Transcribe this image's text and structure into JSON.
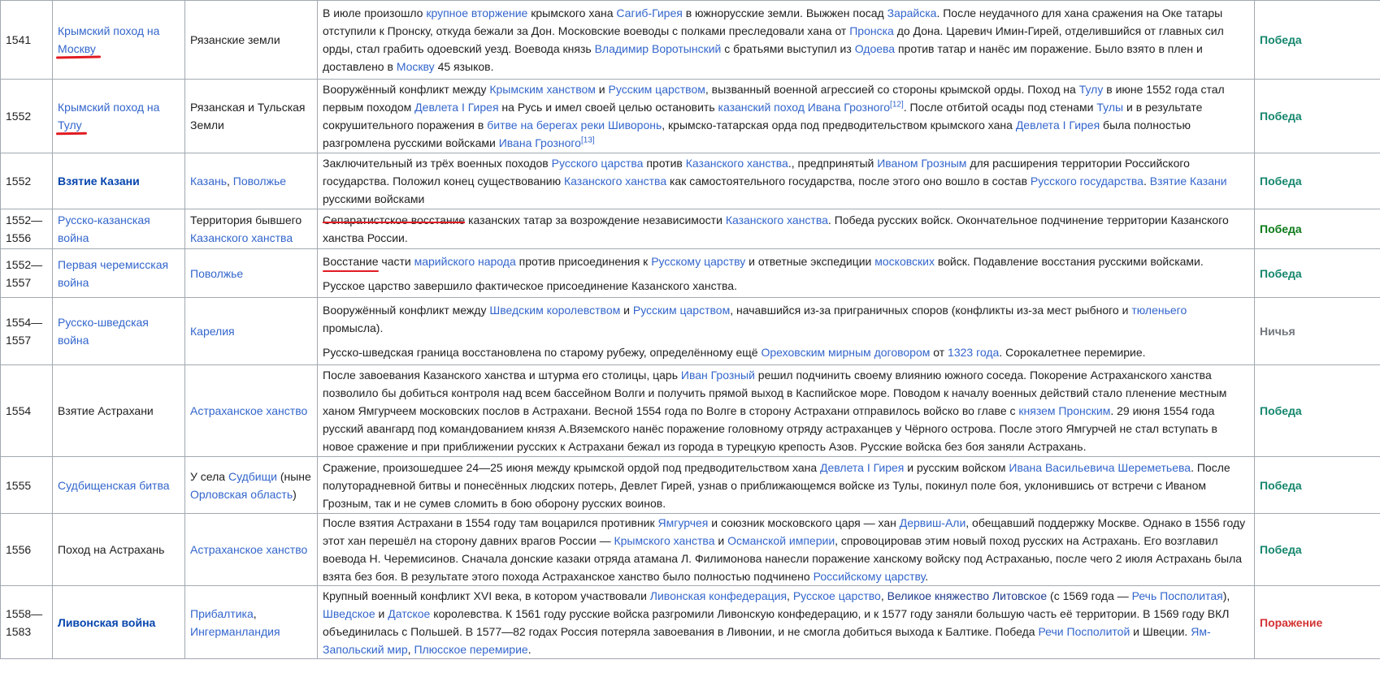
{
  "rows": [
    {
      "year": "1541",
      "name": [
        {
          "t": "Крымский поход на Москву",
          "s": "lk",
          "m": "ul"
        }
      ],
      "place": [
        {
          "t": "Рязанские земли",
          "s": "bl"
        }
      ],
      "desc": [
        [
          {
            "t": "В июле произошло ",
            "s": "bl"
          },
          {
            "t": "крупное вторжение",
            "s": "lk"
          },
          {
            "t": " крымского хана ",
            "s": "bl"
          },
          {
            "t": "Сагиб-Гирея",
            "s": "lk"
          },
          {
            "t": " в южнорусские земли. Выжжен посад ",
            "s": "bl"
          },
          {
            "t": "Зарайска",
            "s": "lk"
          },
          {
            "t": ". После неудачного для хана сражения на Оке татары отступили к Пронску, откуда бежали за Дон. Московские воеводы с полками преследовали хана от ",
            "s": "bl"
          },
          {
            "t": "Пронска",
            "s": "lk"
          },
          {
            "t": " до Дона. Царевич Имин-Гирей, отделившийся от главных сил орды, стал грабить одоевский уезд. Воевода князь ",
            "s": "bl"
          },
          {
            "t": "Владимир Воротынский",
            "s": "lk"
          },
          {
            "t": " с братьями выступил из ",
            "s": "bl"
          },
          {
            "t": "Одоева",
            "s": "lk"
          },
          {
            "t": " против татар и нанёс им поражение. Было взято в плен и доставлено в ",
            "s": "bl"
          },
          {
            "t": "Москву",
            "s": "lk"
          },
          {
            "t": " 45 языков.",
            "s": "bl"
          }
        ]
      ],
      "result": "Победа",
      "rclass": "r-victory"
    },
    {
      "year": "1552",
      "name": [
        {
          "t": "Крымский поход на Тулу",
          "s": "lk",
          "m": "ul"
        }
      ],
      "place": [
        {
          "t": "Рязанская и Тульская Земли",
          "s": "bl"
        }
      ],
      "desc": [
        [
          {
            "t": "Вооружённый конфликт между ",
            "s": "bl"
          },
          {
            "t": "Крымским ханством",
            "s": "lk"
          },
          {
            "t": " и ",
            "s": "bl"
          },
          {
            "t": "Русским царством",
            "s": "lk"
          },
          {
            "t": ", вызванный военной агрессией со стороны крымской орды. Поход на ",
            "s": "bl"
          },
          {
            "t": "Тулу",
            "s": "lk"
          },
          {
            "t": " в июне 1552 года стал первым походом ",
            "s": "bl"
          },
          {
            "t": "Девлета I Гирея",
            "s": "lk"
          },
          {
            "t": " на Русь и имел своей целью остановить ",
            "s": "bl"
          },
          {
            "t": "казанский поход Ивана Грозного",
            "s": "lk"
          },
          {
            "t": "[12]",
            "s": "sup"
          },
          {
            "t": ". После отбитой осады под стенами ",
            "s": "bl"
          },
          {
            "t": "Тулы",
            "s": "lk"
          },
          {
            "t": " и в результате сокрушительного поражения в ",
            "s": "bl"
          },
          {
            "t": "битве на берегах реки Шиворонь",
            "s": "lk"
          },
          {
            "t": ", крымско-татарская орда под предводительством крымского хана ",
            "s": "bl"
          },
          {
            "t": "Девлета I Гирея",
            "s": "lk"
          },
          {
            "t": " была полностью разгромлена русскими войсками ",
            "s": "bl"
          },
          {
            "t": "Ивана Грозного",
            "s": "lk"
          },
          {
            "t": "[13]",
            "s": "sup"
          }
        ]
      ],
      "result": "Победа",
      "rclass": "r-victory"
    },
    {
      "year": "1552",
      "name": [
        {
          "t": "Взятие Казани",
          "s": "lkdb"
        }
      ],
      "place": [
        {
          "t": "Казань",
          "s": "lk"
        },
        {
          "t": ", ",
          "s": "bl"
        },
        {
          "t": "Поволжье",
          "s": "lk"
        }
      ],
      "desc": [
        [
          {
            "t": "Заключительный из трёх военных походов ",
            "s": "bl"
          },
          {
            "t": "Русского царства",
            "s": "lk"
          },
          {
            "t": " против ",
            "s": "bl"
          },
          {
            "t": "Казанского ханства",
            "s": "lk"
          },
          {
            "t": "., предпринятый ",
            "s": "bl"
          },
          {
            "t": "Иваном Грозным",
            "s": "lk"
          },
          {
            "t": " для расширения территории Российского государства. Положил конец существованию ",
            "s": "bl"
          },
          {
            "t": "Казанского ханства",
            "s": "lk"
          },
          {
            "t": " как самостоятельного государства, после этого оно вошло в состав ",
            "s": "bl"
          },
          {
            "t": "Русского государства",
            "s": "lk"
          },
          {
            "t": ". ",
            "s": "bl"
          },
          {
            "t": "Взятие Казани",
            "s": "lk"
          },
          {
            "t": " русскими войсками",
            "s": "bl"
          }
        ]
      ],
      "result": "Победа",
      "rclass": "r-victory"
    },
    {
      "year": "1552—1556",
      "name": [
        {
          "t": "Русско-казанская война",
          "s": "lk"
        }
      ],
      "place": [
        {
          "t": "Территория бывшего ",
          "s": "bl"
        },
        {
          "t": "Казанского ханства",
          "s": "lk"
        }
      ],
      "desc": [
        [
          {
            "t": "Сепаратистское восстание",
            "s": "bl",
            "m": "strike"
          },
          {
            "t": " казанских татар за возрождение независимости ",
            "s": "bl"
          },
          {
            "t": "Казанского ханства",
            "s": "lk"
          },
          {
            "t": ". Победа русских войск. Окончательное подчинение территории Казанского ханства России.",
            "s": "bl"
          }
        ]
      ],
      "result": "Победа",
      "rclass": "r-victory-dark"
    },
    {
      "year": "1552—1557",
      "name": [
        {
          "t": "Первая черемисская война",
          "s": "lk"
        }
      ],
      "place": [
        {
          "t": "Поволжье",
          "s": "lk"
        }
      ],
      "desc": [
        [
          {
            "t": "Восстание",
            "s": "bl",
            "m": "ul2"
          },
          {
            "t": " части ",
            "s": "bl"
          },
          {
            "t": "марийского народа",
            "s": "lk"
          },
          {
            "t": " против присоединения к ",
            "s": "bl"
          },
          {
            "t": "Русскому царству",
            "s": "lk"
          },
          {
            "t": " и ответные экспедиции ",
            "s": "bl"
          },
          {
            "t": "московских",
            "s": "lk"
          },
          {
            "t": " войск. Подавление восстания русскими войсками.",
            "s": "bl"
          }
        ],
        [
          {
            "t": "Русское царство завершило фактическое присоединение Казанского ханства.",
            "s": "bl"
          }
        ]
      ],
      "result": "Победа",
      "rclass": "r-victory"
    },
    {
      "year": "1554—1557",
      "name": [
        {
          "t": "Русско-шведская война",
          "s": "lk"
        }
      ],
      "place": [
        {
          "t": "Карелия",
          "s": "lk"
        }
      ],
      "desc": [
        [
          {
            "t": "Вооружённый конфликт между ",
            "s": "bl"
          },
          {
            "t": "Шведским королевством",
            "s": "lk"
          },
          {
            "t": " и ",
            "s": "bl"
          },
          {
            "t": "Русским царством",
            "s": "lk"
          },
          {
            "t": ", начавшийся из-за приграничных споров (конфликты из-за мест рыбного и ",
            "s": "bl"
          },
          {
            "t": "тюленьего",
            "s": "lk"
          },
          {
            "t": " промысла).",
            "s": "bl"
          }
        ],
        [
          {
            "t": "Русско-шведская граница восстановлена по старому рубежу, определённому ещё ",
            "s": "bl"
          },
          {
            "t": "Ореховским мирным договором",
            "s": "lk"
          },
          {
            "t": " от ",
            "s": "bl"
          },
          {
            "t": "1323 года",
            "s": "lk"
          },
          {
            "t": ". Сорокалетнее перемирие.",
            "s": "bl"
          }
        ]
      ],
      "result": "Ничья",
      "rclass": "r-draw"
    },
    {
      "year": "1554",
      "name": [
        {
          "t": "Взятие Астрахани",
          "s": "bl"
        }
      ],
      "place": [
        {
          "t": "Астраханское ханство",
          "s": "lk"
        }
      ],
      "desc": [
        [
          {
            "t": "После завоевания Казанского ханства и штурма его столицы, царь ",
            "s": "bl"
          },
          {
            "t": "Иван Грозный",
            "s": "lk"
          },
          {
            "t": " решил подчинить своему влиянию южного соседа. Покорение Астраханского ханства позволило бы добиться контроля над всем бассейном Волги и получить прямой выход в Каспийское море. Поводом к началу военных действий стало пленение местным ханом Ямгурчеем московских послов в Астрахани. Весной 1554 года по Волге в сторону Астрахани отправилось войско во главе с ",
            "s": "bl"
          },
          {
            "t": "князем Пронским",
            "s": "lk"
          },
          {
            "t": ". 29 июня 1554 года русский авангард под командованием князя А.Вяземского нанёс поражение головному отряду астраханцев у Чёрного острова. После этого Ямгурчей не стал вступать в новое сражение и при приближении русских к Астрахани бежал из города в турецкую крепость Азов. Русские войска без боя заняли Астрахань.",
            "s": "bl"
          }
        ]
      ],
      "result": "Победа",
      "rclass": "r-victory"
    },
    {
      "year": "1555",
      "name": [
        {
          "t": "Судбищенская битва",
          "s": "lk"
        }
      ],
      "place": [
        {
          "t": "У села ",
          "s": "bl"
        },
        {
          "t": "Судбищи",
          "s": "lk"
        },
        {
          "t": " (ныне ",
          "s": "bl"
        },
        {
          "t": "Орловская область",
          "s": "lk"
        },
        {
          "t": ")",
          "s": "bl"
        }
      ],
      "desc": [
        [
          {
            "t": "Сражение, произошедшее 24—25 июня между крымской ордой под предводительством хана ",
            "s": "bl"
          },
          {
            "t": "Девлета I Гирея",
            "s": "lk"
          },
          {
            "t": " и русским войском ",
            "s": "bl"
          },
          {
            "t": "Ивана Васильевича Шереметьева",
            "s": "lk"
          },
          {
            "t": ". После полуторадневной битвы и понесённых людских потерь, Девлет Гирей, узнав о приближающемся войске из Тулы, покинул поле боя, уклонившись от встречи с Иваном Грозным, так и не сумев сломить в бою оборону русских воинов.",
            "s": "bl"
          }
        ]
      ],
      "result": "Победа",
      "rclass": "r-victory"
    },
    {
      "year": "1556",
      "name": [
        {
          "t": "Поход на Астрахань",
          "s": "bl"
        }
      ],
      "place": [
        {
          "t": "Астраханское ханство",
          "s": "lk"
        }
      ],
      "desc": [
        [
          {
            "t": "После взятия Астрахани в 1554 году там воцарился противник ",
            "s": "bl"
          },
          {
            "t": "Ямгурчея",
            "s": "lk"
          },
          {
            "t": " и союзник московского царя — хан ",
            "s": "bl"
          },
          {
            "t": "Дервиш-Али",
            "s": "lk"
          },
          {
            "t": ", обещавший поддержку Москве. Однако в 1556 году этот хан перешёл на сторону давних врагов России — ",
            "s": "bl"
          },
          {
            "t": "Крымского ханства",
            "s": "lk"
          },
          {
            "t": " и ",
            "s": "bl"
          },
          {
            "t": "Османской империи",
            "s": "lk"
          },
          {
            "t": ", спровоцировав этим новый поход русских на Астрахань. Его возглавил воевода Н. Черемисинов. Сначала донские казаки отряда атамана Л. Филимонова нанесли поражение ханскому войску под Астраханью, после чего 2 июля Астрахань была взята без боя. В результате этого похода Астраханское ханство было полностью подчинено ",
            "s": "bl"
          },
          {
            "t": "Российскому царству",
            "s": "lk"
          },
          {
            "t": ".",
            "s": "bl"
          }
        ]
      ],
      "result": "Победа",
      "rclass": "r-victory"
    },
    {
      "year": "1558—1583",
      "name": [
        {
          "t": "Ливонская война",
          "s": "lkdb"
        }
      ],
      "place": [
        {
          "t": "Прибалтика",
          "s": "lk"
        },
        {
          "t": ", ",
          "s": "bl"
        },
        {
          "t": "Ингерманландия",
          "s": "lk"
        }
      ],
      "desc": [
        [
          {
            "t": "Крупный военный конфликт XVI века, в котором участвовали ",
            "s": "bl"
          },
          {
            "t": "Ливонская конфедерация",
            "s": "lk"
          },
          {
            "t": ", ",
            "s": "bl"
          },
          {
            "t": "Русское царство",
            "s": "lk"
          },
          {
            "t": ", ",
            "s": "bl"
          },
          {
            "t": "Великое княжество Литовское",
            "s": "vis"
          },
          {
            "t": " (с 1569 года — ",
            "s": "bl"
          },
          {
            "t": "Речь Посполитая",
            "s": "lk"
          },
          {
            "t": "), ",
            "s": "bl"
          },
          {
            "t": "Шведское",
            "s": "lk"
          },
          {
            "t": " и ",
            "s": "bl"
          },
          {
            "t": "Датское",
            "s": "lk"
          },
          {
            "t": " королевства. К 1561 году русские войска разгромили Ливонскую конфедерацию, и к 1577 году заняли большую часть её территории. В 1569 году ВКЛ объединилась с Польшей. В 1577—82 годах Россия потеряла завоевания в Ливонии, и не смогла добиться выхода к Балтике. Победа ",
            "s": "bl"
          },
          {
            "t": "Речи Посполитой",
            "s": "lk"
          },
          {
            "t": " и Швеции. ",
            "s": "bl"
          },
          {
            "t": "Ям-Запольский мир",
            "s": "lk"
          },
          {
            "t": ", ",
            "s": "bl"
          },
          {
            "t": "Плюсское перемирие",
            "s": "lk"
          },
          {
            "t": ".",
            "s": "bl"
          }
        ]
      ],
      "result": "Поражение",
      "rclass": "r-defeat"
    }
  ]
}
